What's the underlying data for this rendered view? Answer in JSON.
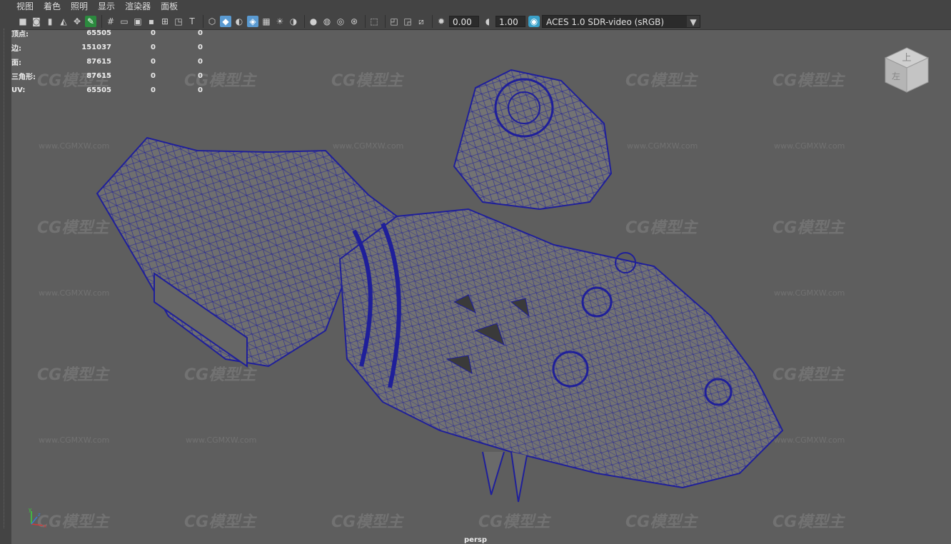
{
  "menu": {
    "items": [
      "视图",
      "着色",
      "照明",
      "显示",
      "渲染器",
      "面板"
    ]
  },
  "toolbar": {
    "exposure_value": "0.00",
    "gamma_value": "1.00",
    "color_space": "ACES 1.0 SDR-video (sRGB)",
    "icons": [
      "camera-select-icon",
      "camera-attributes-icon",
      "bookmark-icon",
      "image-plane-icon",
      "2d-pan-icon",
      "grease-pencil-icon",
      "grid-icon",
      "film-gate-icon",
      "resolution-gate-icon",
      "gate-mask-icon",
      "field-chart-icon",
      "safe-action-icon",
      "safe-title-icon",
      "wireframe-icon",
      "smooth-shade-icon",
      "default-material-icon",
      "wireframe-on-shaded-icon",
      "textured-icon",
      "lights-icon",
      "shadows-icon",
      "ambient-occlusion-icon",
      "motion-blur-icon",
      "anti-aliasing-icon",
      "depth-of-field-icon",
      "isolate-select-icon",
      "xray-icon",
      "xray-joints-icon",
      "backface-culling-icon",
      "exposure-icon",
      "gamma-icon",
      "color-management-icon"
    ]
  },
  "hud": {
    "rows": [
      {
        "label": "顶点:",
        "v1": "65505",
        "v2": "0",
        "v3": "0"
      },
      {
        "label": "边:",
        "v1": "151037",
        "v2": "0",
        "v3": "0"
      },
      {
        "label": "面:",
        "v1": "87615",
        "v2": "0",
        "v3": "0"
      },
      {
        "label": "三角形:",
        "v1": "87615",
        "v2": "0",
        "v3": "0"
      },
      {
        "label": "UV:",
        "v1": "65505",
        "v2": "0",
        "v3": "0"
      }
    ]
  },
  "viewport": {
    "camera_name": "persp",
    "viewcube_top": "上",
    "viewcube_left": "左",
    "watermark_text": "CG模型主",
    "watermark_url": "www.CGMXW.com",
    "axis_labels": [
      "x",
      "y",
      "z"
    ],
    "wire_color": "#1f1f9a",
    "surface_color": "#6f6f6f"
  }
}
